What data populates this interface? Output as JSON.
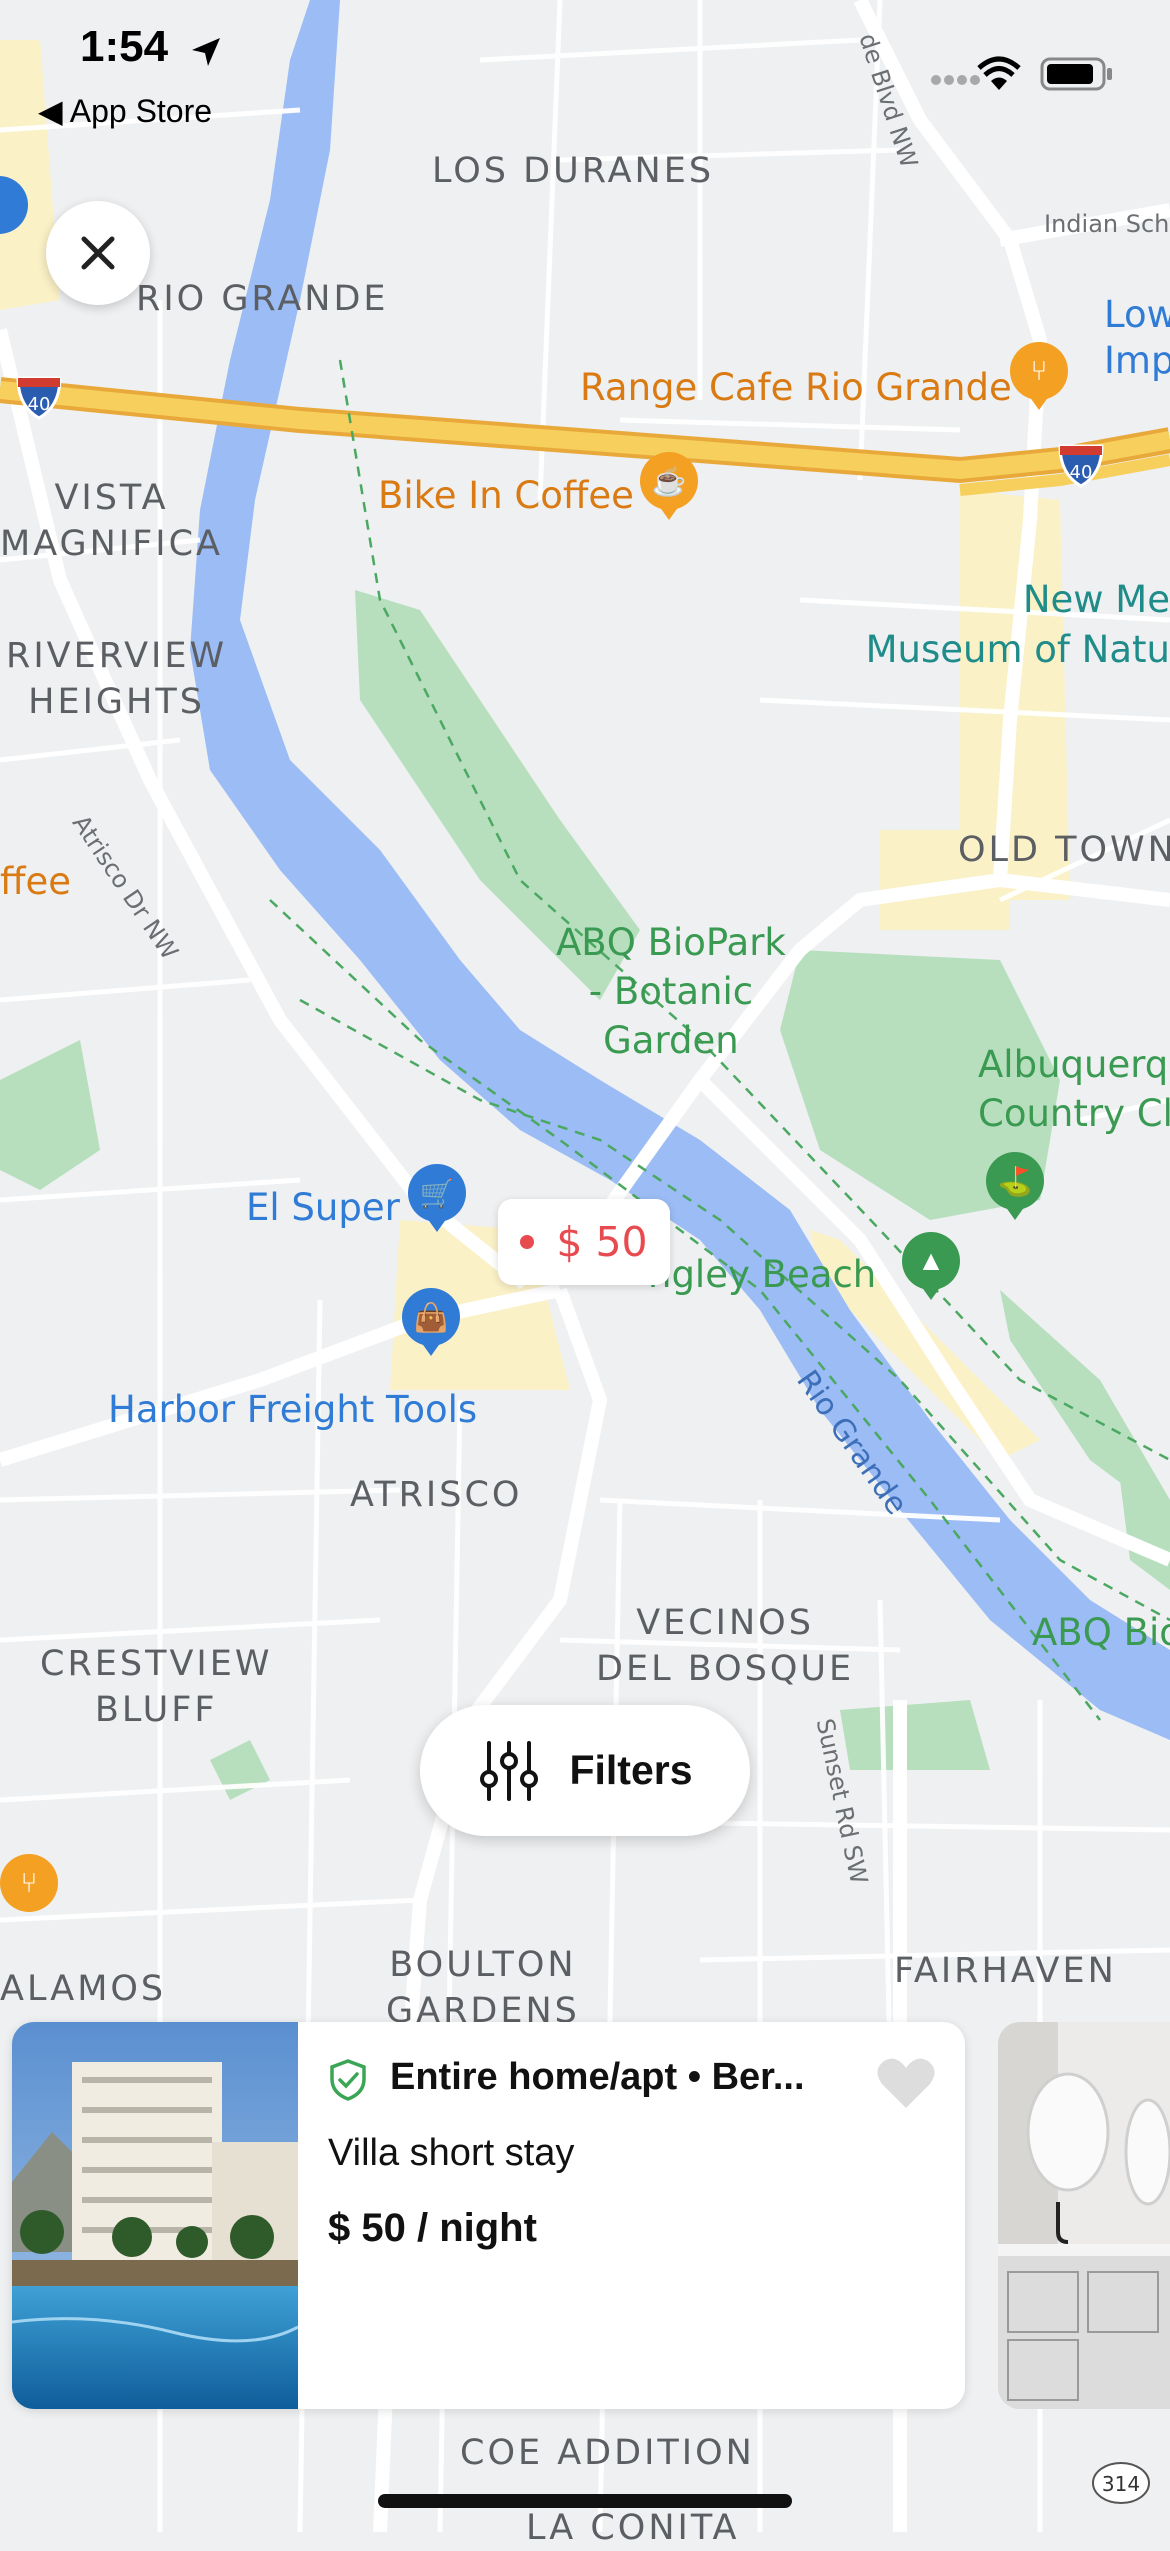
{
  "status_bar": {
    "time": "1:54",
    "back_label": "◀ App Store"
  },
  "map": {
    "areas": [
      "LOS DURANES",
      "RIO GRANDE",
      "VISTA\nMAGNIFICA",
      "RIVERVIEW\nHEIGHTS",
      "OLD TOWN",
      "ATRISCO",
      "VECINOS\nDEL BOSQUE",
      "CRESTVIEW\nBLUFF",
      "BOULTON\nGARDENS",
      "FAIRHAVEN",
      "ALAMOS",
      "COE ADDITION",
      "LA CONITA"
    ],
    "pois": {
      "range_cafe": "Range Cafe Rio Grande",
      "bike_in_coffee": "Bike In Coffee",
      "new_mexico_museum": "New Me\nMuseum of Natu",
      "low_imp": "Low\nImp",
      "abq_biopark": "ABQ BioPark\n- Botanic\nGarden",
      "albuquerque_cc": "Albuquerqu\nCountry Cl",
      "el_super": "El Super",
      "harbor_freight": "Harbor Freight Tools",
      "tingley_beach": "ngley Beach",
      "abq_bio_right": "ABQ Bio",
      "coffee_left": "ffee"
    },
    "streets": {
      "atrisco": "Atrisco Dr NW",
      "sunset": "Sunset Rd SW",
      "indian_school": "Indian Sch",
      "rio_grande_blvd": "de Blvd NW",
      "rio_grande_river": "Rio Grande"
    },
    "shields": {
      "i40_left": "40",
      "i40_right": "40",
      "route_314": "314"
    }
  },
  "price_marker": {
    "label": "$ 50"
  },
  "filters_button": {
    "label": "Filters"
  },
  "listing_card": {
    "title": "Entire home/apt • Ber...",
    "subtitle": "Villa short stay",
    "price": "$ 50 / night"
  },
  "colors": {
    "accent": "#e74b50",
    "water": "#9bbcf5",
    "park": "#b7dfbe",
    "highway": "#f3c44a",
    "poi_orange": "#f4a023",
    "poi_blue": "#2f7bd6",
    "poi_green": "#3a9a52"
  }
}
